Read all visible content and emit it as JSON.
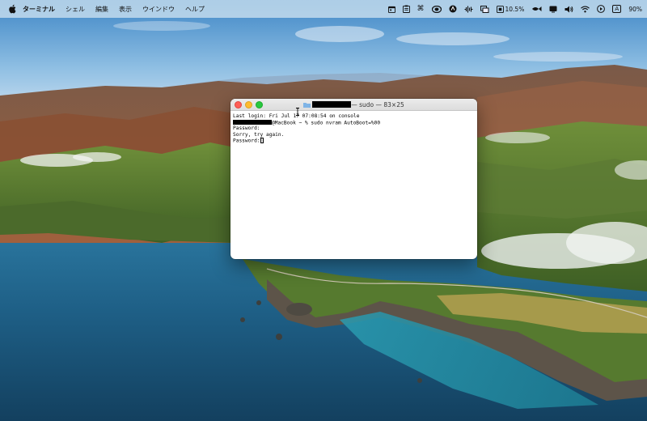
{
  "menubar": {
    "app_name": "ターミナル",
    "menus": [
      "シェル",
      "編集",
      "表示",
      "ウインドウ",
      "ヘルプ"
    ],
    "status_icons": [
      "calendar-icon",
      "clipboard-icon",
      "command-icon",
      "creative-cloud-icon",
      "app-circle-icon",
      "audio-wave-icon",
      "window-overlay-icon"
    ],
    "cpu_temp": "10.5%",
    "extra_icons": [
      "fish-icon",
      "display-icon",
      "volume-icon",
      "wifi-icon",
      "play-icon"
    ],
    "input_source": "A",
    "battery": "90%"
  },
  "terminal": {
    "title": "— sudo — 83×25",
    "lines": {
      "last_login": "Last login: Fri Jul 17 07:08:54 on console",
      "command": "@MacBook ~ % sudo nvram AutoBoot=%00",
      "password1": "Password:",
      "sorry": "Sorry, try again.",
      "password2": "Password:"
    }
  },
  "colors": {
    "close": "#ff5f57",
    "minimize": "#febc2e",
    "maximize": "#28c840"
  }
}
